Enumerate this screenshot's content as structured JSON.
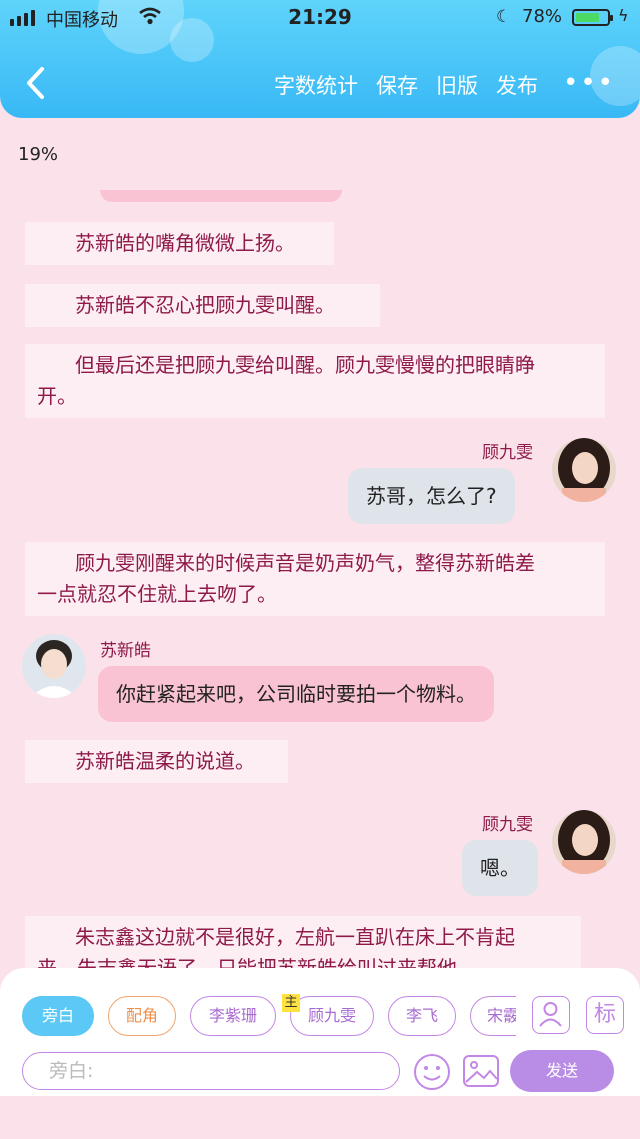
{
  "status_bar": {
    "carrier": "中国移动",
    "time": "21:29",
    "battery_percent": "78%",
    "battery_level": 0.78
  },
  "header": {
    "nav": [
      "字数统计",
      "保存",
      "旧版",
      "发布"
    ],
    "more": "•••"
  },
  "progress": "19%",
  "messages": {
    "n1": "苏新皓的嘴角微微上扬。",
    "n2": "苏新皓不忍心把顾九雯叫醒。",
    "n3a": "但最后还是把顾九雯给叫醒。顾九雯慢慢的把眼睛睁",
    "n3b": "开。",
    "s1_name": "顾九雯",
    "s1_text": "苏哥，怎么了?",
    "n4a": "顾九雯刚醒来的时候声音是奶声奶气，整得苏新皓差",
    "n4b": "一点就忍不住就上去吻了。",
    "s2_name": "苏新皓",
    "s2_text": "你赶紧起来吧，公司临时要拍一个物料。",
    "n5": "苏新皓温柔的说道。",
    "s3_name": "顾九雯",
    "s3_text": "嗯。",
    "n6a": "朱志鑫这边就不是很好，左航一直趴在床上不肯起",
    "n6b": "来，朱志鑫无语了。只能把苏新皓给叫过来帮他。"
  },
  "roles": {
    "narration": "旁白",
    "supporting": "配角",
    "r1": "李紫珊",
    "r2": "顾九雯",
    "r3": "李飞",
    "r4": "宋霰",
    "main_badge": "主",
    "tag": "标"
  },
  "composer": {
    "placeholder": "旁白:",
    "send": "发送"
  },
  "colors": {
    "header": "#38b8f5",
    "background": "#fbe1ea",
    "narration_text": "#8e1a4a",
    "send": "#b98ce6",
    "active_chip": "#5cc8f5"
  }
}
